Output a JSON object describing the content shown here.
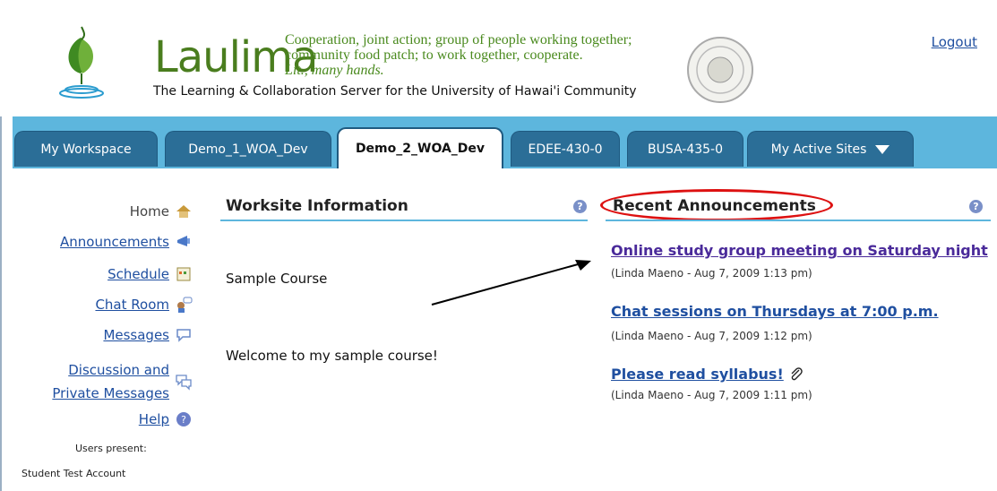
{
  "header": {
    "logo_word": "Laulima",
    "tagline_lines": [
      "Cooperation, joint action; group of people working together;",
      "community food patch; to work together, cooperate.",
      "Lit., many hands."
    ],
    "subtitle": "The Learning & Collaboration Server for the University of Hawai'i Community",
    "logout": "Logout"
  },
  "tabs": [
    {
      "label": "My Workspace"
    },
    {
      "label": "Demo_1_WOA_Dev"
    },
    {
      "label": "Demo_2_WOA_Dev",
      "active": true
    },
    {
      "label": "EDEE-430-0"
    },
    {
      "label": "BUSA-435-0"
    },
    {
      "label": "My Active Sites"
    }
  ],
  "nav": {
    "home": "Home",
    "announcements": "Announcements",
    "schedule": "Schedule",
    "chat_room": "Chat Room",
    "messages": "Messages",
    "discussion_line1": "Discussion and",
    "discussion_line2": "Private Messages",
    "help": "Help",
    "users_present_label": "Users present:",
    "users_present_name": "Student Test Account"
  },
  "worksite": {
    "title": "Worksite Information",
    "course": "Sample Course",
    "welcome": "Welcome to my sample course!"
  },
  "announcements": {
    "title": "Recent Announcements",
    "items": [
      {
        "title": "Online study group meeting on Saturday night",
        "meta": "(Linda Maeno - Aug 7, 2009 1:13 pm)"
      },
      {
        "title": "Chat sessions on Thursdays at 7:00 p.m.",
        "meta": "(Linda Maeno - Aug 7, 2009 1:12 pm)"
      },
      {
        "title": "Please read syllabus!",
        "meta": "(Linda Maeno - Aug 7, 2009 1:11 pm)"
      }
    ]
  },
  "colors": {
    "tabbar": "#5db6dd",
    "tab": "#2b6e97",
    "link": "#1f4fa0",
    "annotation": "#d11111"
  }
}
